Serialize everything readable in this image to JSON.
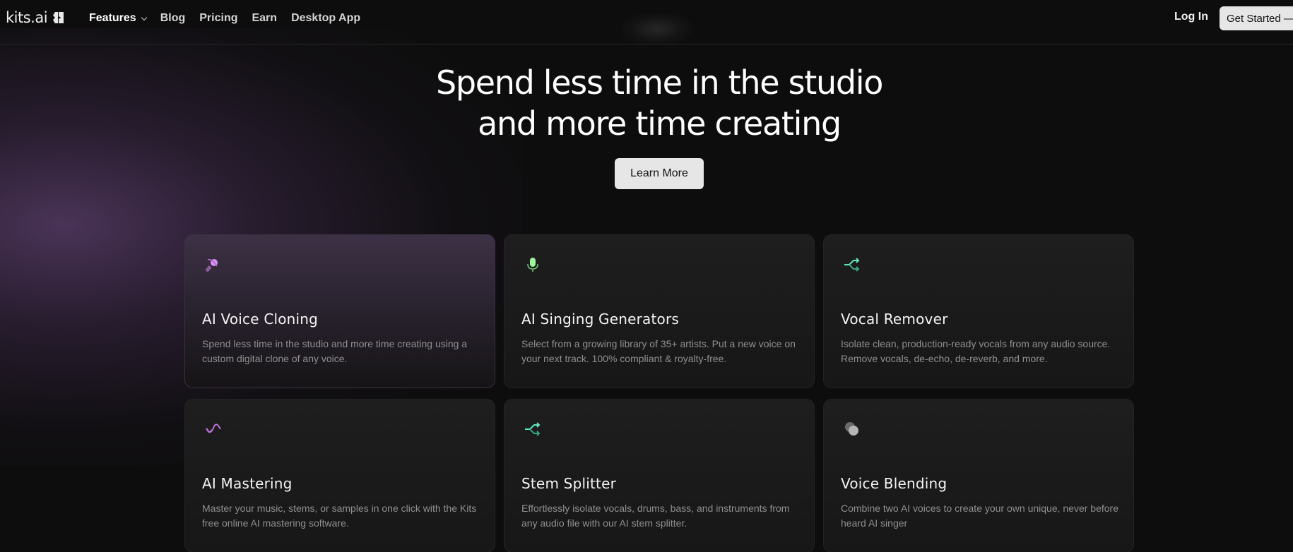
{
  "brand": {
    "name": "kits.ai"
  },
  "nav": {
    "links": [
      {
        "label": "Features",
        "has_dropdown": true
      },
      {
        "label": "Blog"
      },
      {
        "label": "Pricing"
      },
      {
        "label": "Earn"
      },
      {
        "label": "Desktop App"
      }
    ],
    "login_label": "Log In",
    "get_started_label": "Get Started —"
  },
  "hero": {
    "title_line1": "Spend less time in the studio",
    "title_line2": "and more time creating",
    "cta_label": "Learn More"
  },
  "features": [
    {
      "icon": "voice-clone-icon",
      "title": "AI Voice Cloning",
      "description": "Spend less time in the studio and more time creating using a custom digital clone of any voice.",
      "accent": "#d98ef5"
    },
    {
      "icon": "microphone-icon",
      "title": "AI Singing Generators",
      "description": "Select from a growing library of 35+ artists. Put a new voice on your next track. 100% compliant & royalty-free.",
      "accent": "#9ef59a"
    },
    {
      "icon": "split-arrows-icon",
      "title": "Vocal Remover",
      "description": "Isolate clean, production-ready vocals from any audio source. Remove vocals, de-echo, de-reverb, and more.",
      "accent": "#5fe8c0"
    },
    {
      "icon": "waveform-icon",
      "title": "AI Mastering",
      "description": "Master your music, stems, or samples in one click with the Kits free online AI mastering software.",
      "accent": "#c77be8"
    },
    {
      "icon": "split-arrows-icon",
      "title": "Stem Splitter",
      "description": " Effortlessly isolate vocals, drums, bass, and instruments from any audio file with our AI stem splitter.",
      "accent": "#5fe8c0"
    },
    {
      "icon": "blend-circles-icon",
      "title": "Voice Blending",
      "description": "Combine two AI voices to create your own unique, never before heard AI singer",
      "accent": "#b5b5b5"
    }
  ]
}
